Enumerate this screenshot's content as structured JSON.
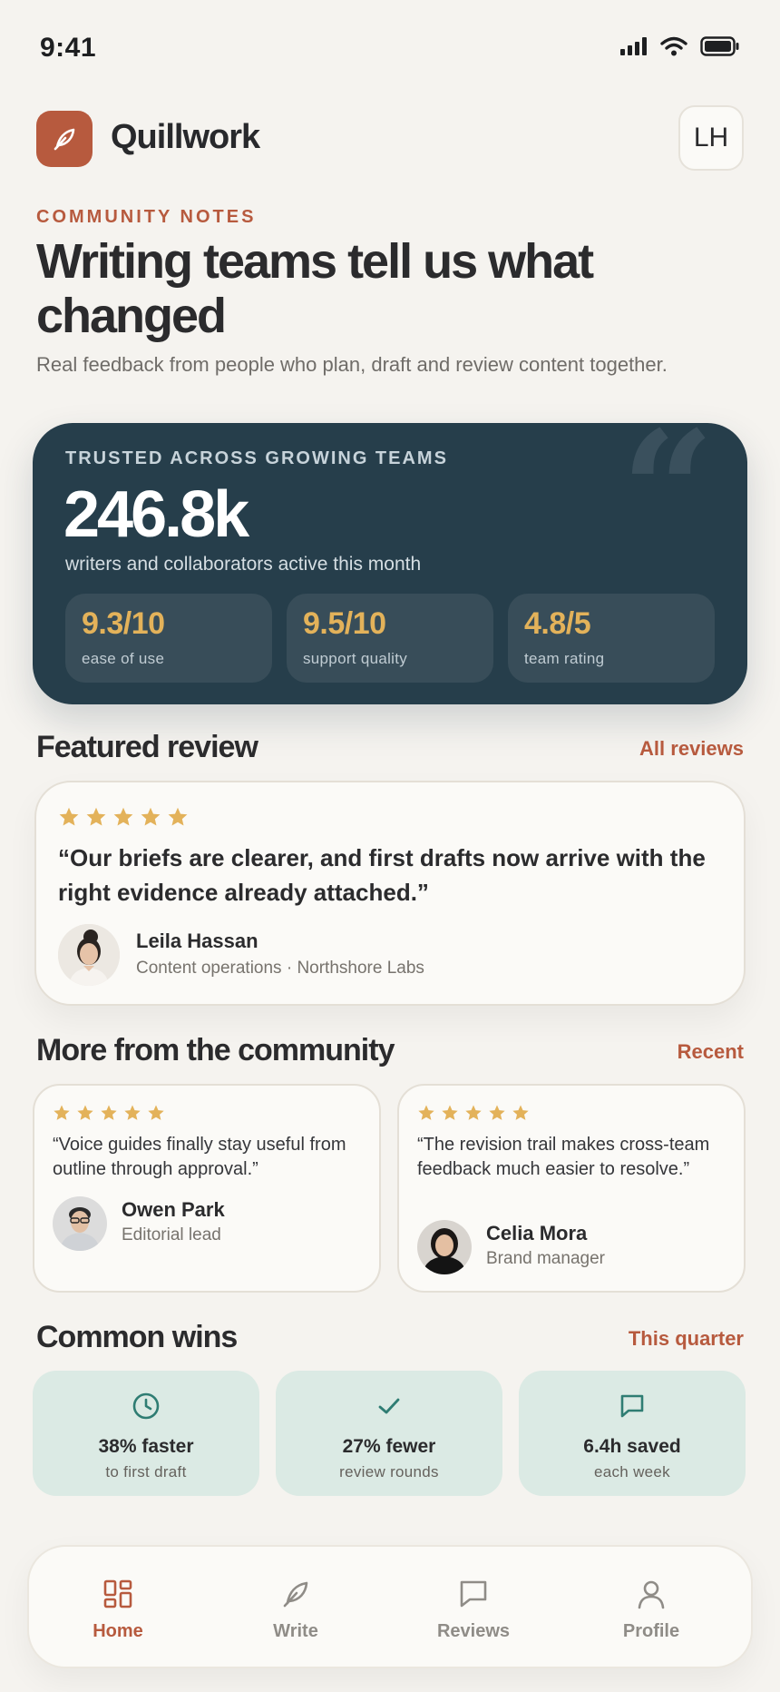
{
  "status": {
    "time": "9:41"
  },
  "header": {
    "brand": "Quillwork",
    "avatar_initials": "LH"
  },
  "hero": {
    "eyebrow": "COMMUNITY NOTES",
    "title": "Writing teams tell us what changed",
    "subtitle": "Real feedback from people who plan, draft and review content together."
  },
  "stats": {
    "eyebrow": "TRUSTED ACROSS GROWING TEAMS",
    "big_number": "246.8k",
    "caption": "writers and collaborators active this month",
    "metrics": [
      {
        "value": "9.3/10",
        "label": "ease of use"
      },
      {
        "value": "9.5/10",
        "label": "support quality"
      },
      {
        "value": "4.8/5",
        "label": "team rating"
      }
    ]
  },
  "featured": {
    "title": "Featured review",
    "link": "All reviews",
    "rating": 5,
    "quote": "“Our briefs are clearer, and first drafts now arrive with the right evidence already attached.”",
    "name": "Leila Hassan",
    "role": "Content operations · Northshore Labs"
  },
  "community": {
    "title": "More from the community",
    "link": "Recent",
    "reviews": [
      {
        "rating": 5,
        "quote": "“Voice guides finally stay useful from outline through approval.”",
        "name": "Owen Park",
        "role": "Editorial lead"
      },
      {
        "rating": 5,
        "quote": "“The revision trail makes cross-team feedback much easier to resolve.”",
        "name": "Celia Mora",
        "role": "Brand manager"
      }
    ]
  },
  "wins": {
    "title": "Common wins",
    "link": "This quarter",
    "items": [
      {
        "icon": "clock-icon",
        "value": "38% faster",
        "label": "to first draft"
      },
      {
        "icon": "check-icon",
        "value": "27% fewer",
        "label": "review rounds"
      },
      {
        "icon": "chat-bubble-icon",
        "value": "6.4h saved",
        "label": "each week"
      }
    ]
  },
  "tabs": [
    {
      "label": "Home",
      "icon": "dashboard-icon",
      "active": true
    },
    {
      "label": "Write",
      "icon": "feather-icon",
      "active": false
    },
    {
      "label": "Reviews",
      "icon": "chat-bubble-icon",
      "active": false
    },
    {
      "label": "Profile",
      "icon": "person-icon",
      "active": false
    }
  ],
  "colors": {
    "accent": "#b75a3e",
    "stats_bg": "#263e4b",
    "gold": "#e3b25a",
    "win_bg": "#dbeae4",
    "page_bg": "#f5f3ef"
  }
}
